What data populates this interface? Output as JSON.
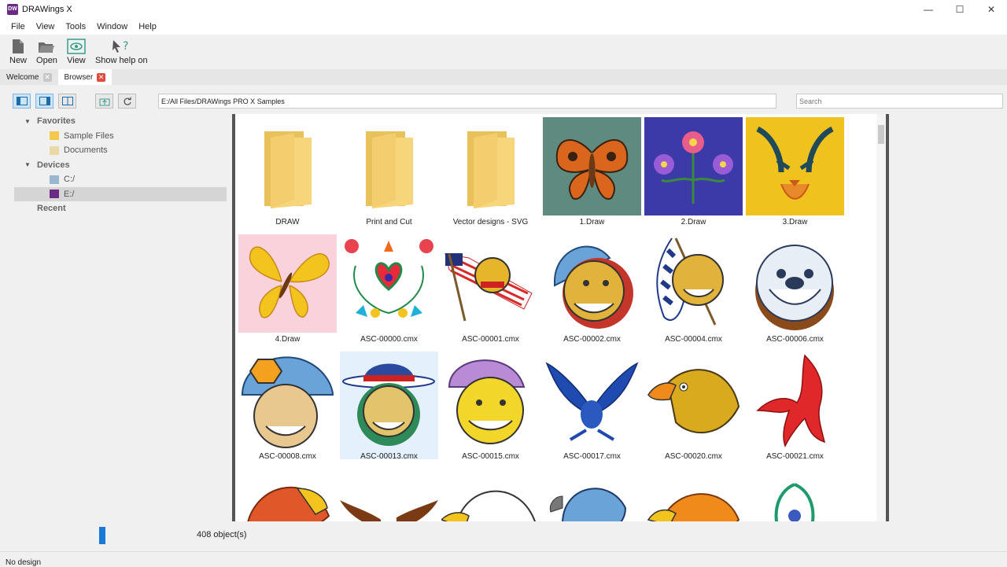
{
  "window": {
    "title": "DRAWings X",
    "minimize": "—",
    "maximize": "☐",
    "close": "✕"
  },
  "menu": [
    "File",
    "View",
    "Tools",
    "Window",
    "Help"
  ],
  "toolbar": {
    "new": "New",
    "open": "Open",
    "view": "View",
    "help": "Show help on"
  },
  "tabs": [
    {
      "label": "Welcome",
      "active": false
    },
    {
      "label": "Browser",
      "active": true
    }
  ],
  "browser": {
    "path": "E:/All Files/DRAWings PRO X Samples",
    "search_placeholder": "Search"
  },
  "tree": {
    "favorites": "Favorites",
    "sample_files": "Sample Files",
    "documents": "Documents",
    "devices": "Devices",
    "drive_c": "C:/",
    "drive_e": "E:/",
    "recent": "Recent"
  },
  "items": [
    "DRAW",
    "Print and Cut",
    "Vector designs - SVG",
    "1.Draw",
    "2.Draw",
    "3.Draw",
    "4.Draw",
    "ASC-00000.cmx",
    "ASC-00001.cmx",
    "ASC-00002.cmx",
    "ASC-00004.cmx",
    "ASC-00006.cmx",
    "ASC-00008.cmx",
    "ASC-00013.cmx",
    "ASC-00015.cmx",
    "ASC-00017.cmx",
    "ASC-00020.cmx",
    "ASC-00021.cmx"
  ],
  "status": {
    "object_count": "408 object(s)",
    "design": "No design"
  },
  "colors": {
    "accent": "#1a78d8",
    "tab_close_active": "#e04b3e",
    "selection": "#e4f0fb"
  }
}
